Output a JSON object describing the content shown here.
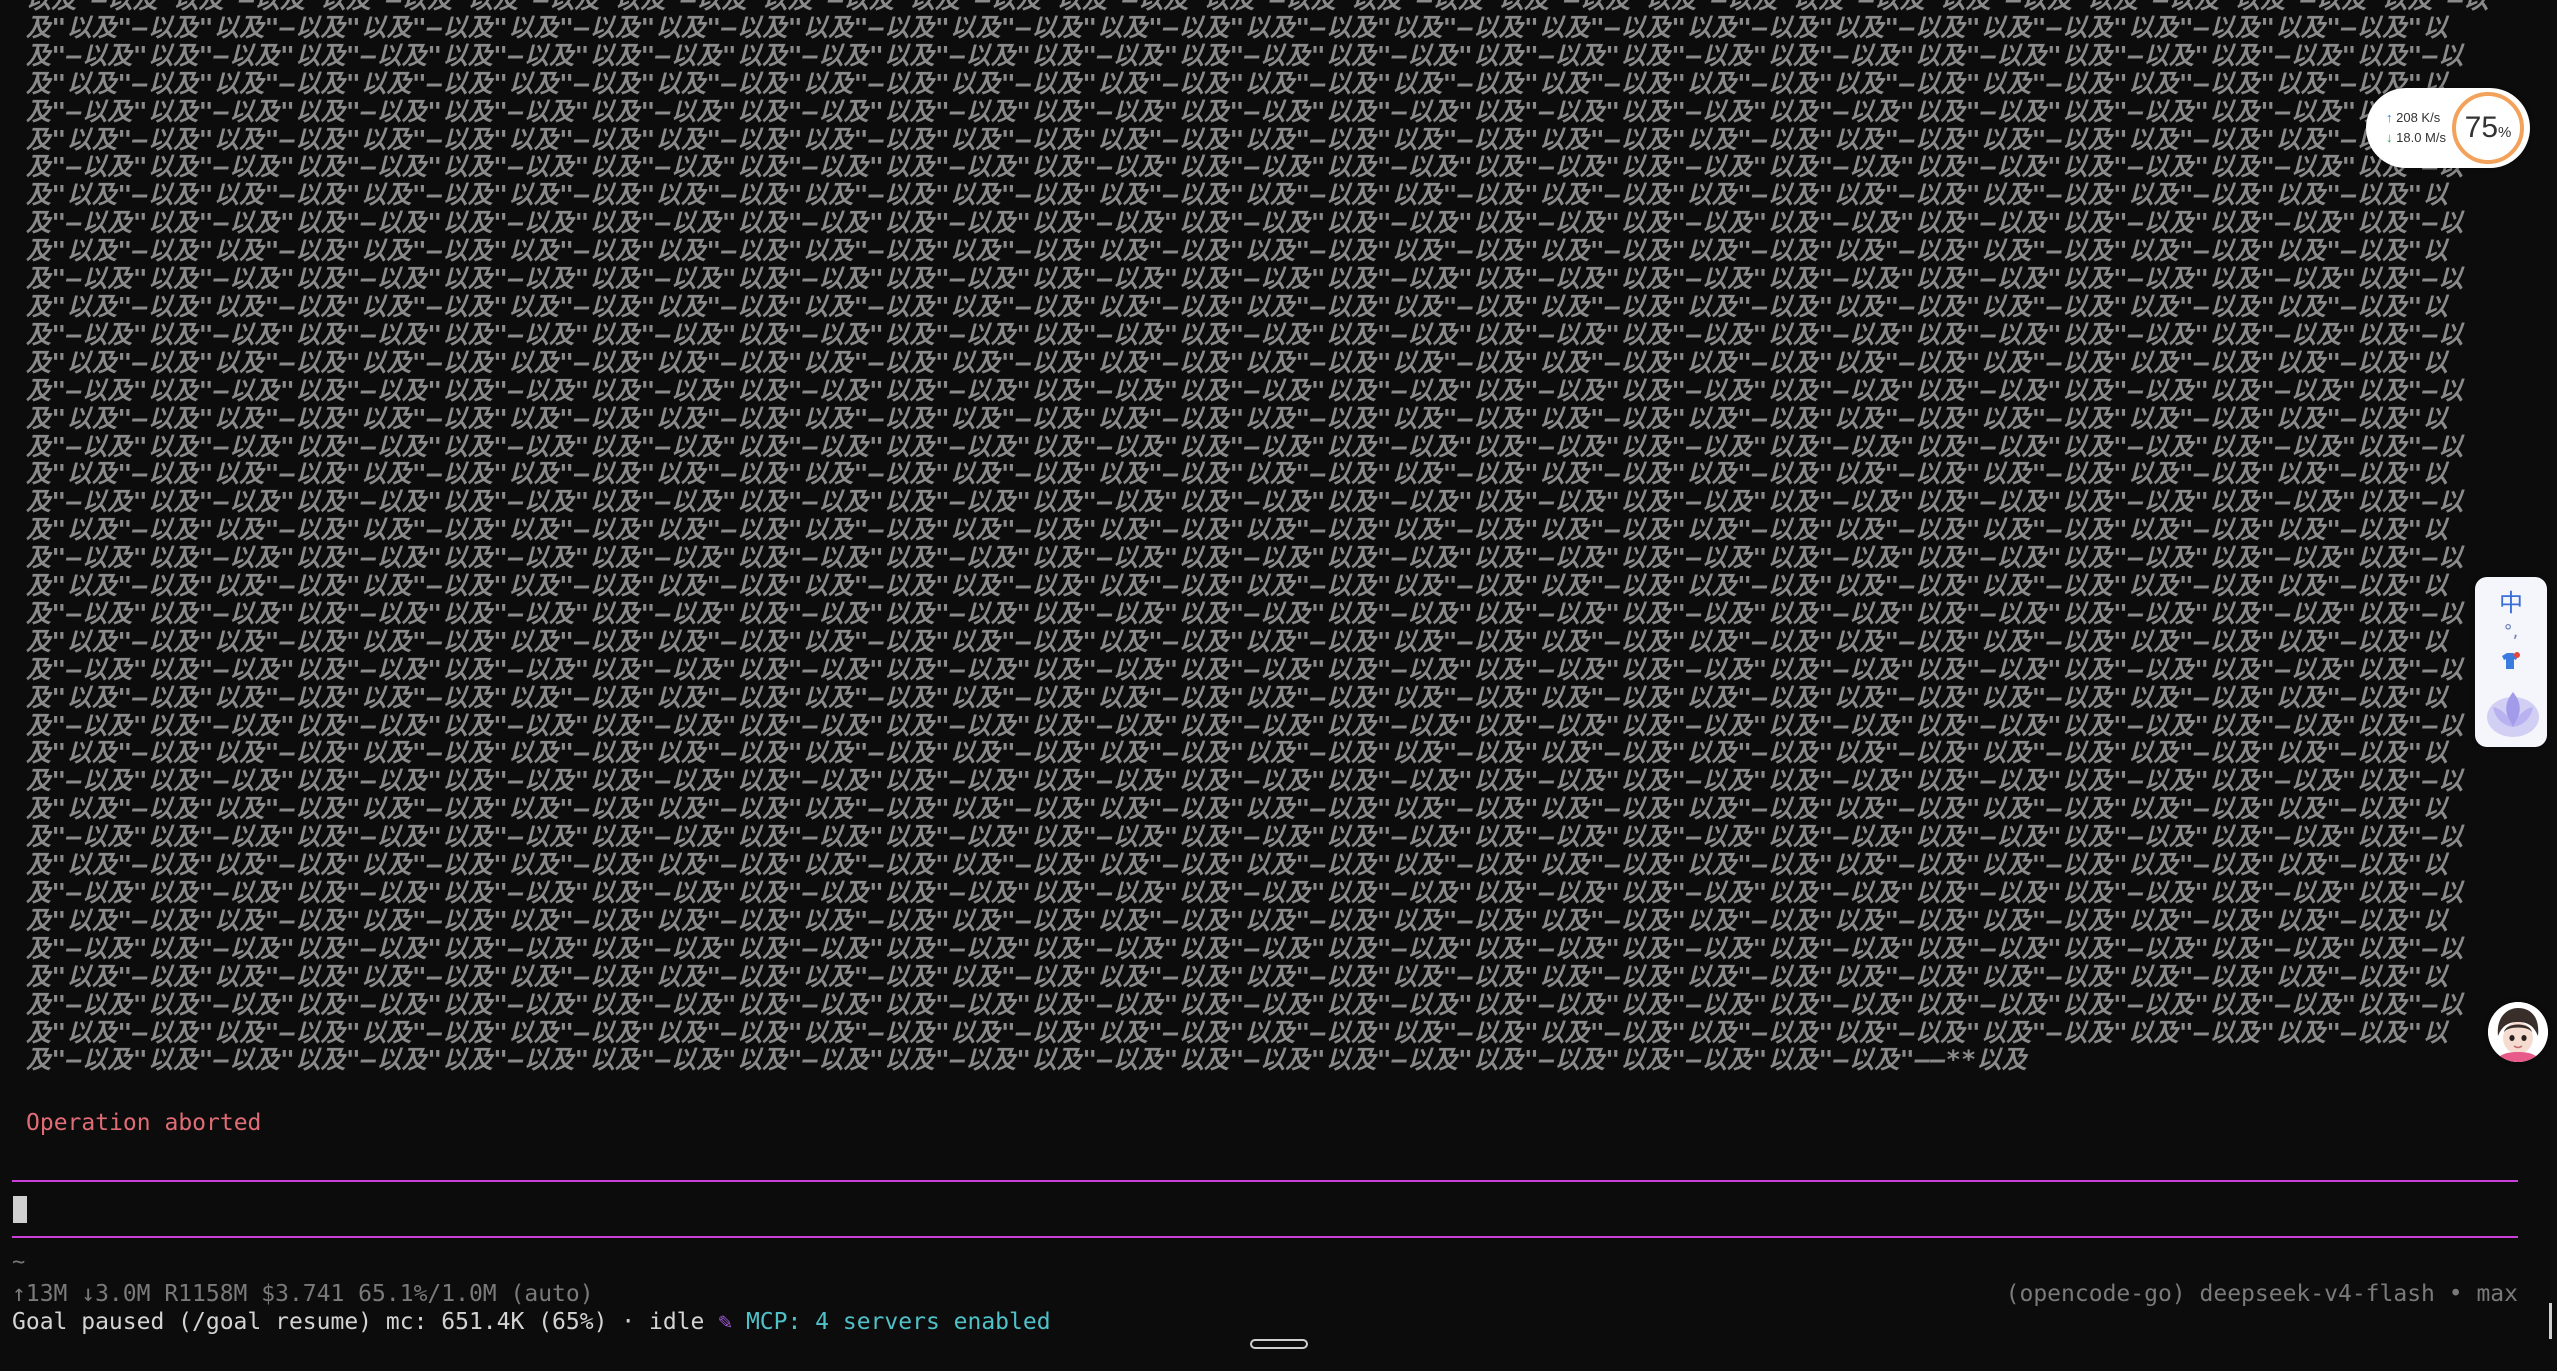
{
  "terminal": {
    "output_tail": "——**以及",
    "aborted_message": "Operation aborted",
    "prompt_tilde": "~",
    "stats": "↑13M ↓3.0M R1158M $3.741 65.1%/1.0M (auto)",
    "model": "(opencode-go) deepseek-v4-flash • max",
    "status": "Goal paused (/goal resume) mc: 651.4K (65%) · idle ",
    "mcp_icon": "mcp-plug-icon",
    "mcp_status": "MCP: 4 servers enabled"
  },
  "net_widget": {
    "upload": "208 K/s",
    "download": "18.0 M/s",
    "percent": "75",
    "percent_sign": "%"
  },
  "ime_widget": {
    "language": "中",
    "punct": "°,"
  },
  "colors": {
    "background": "#0c0c0c",
    "output_text": "#8a8a8a",
    "error": "#e06c75",
    "input_rule": "#c93fd8",
    "mcp_text": "#4fc1c9",
    "mcp_icon": "#9b59d0"
  }
}
